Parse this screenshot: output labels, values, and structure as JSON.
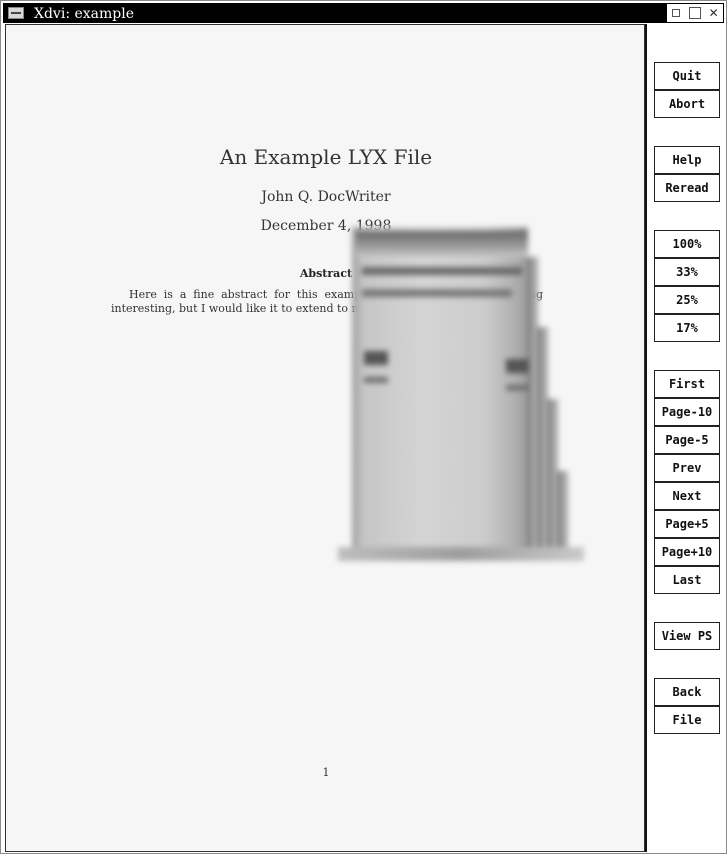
{
  "window": {
    "title": "Xdvi:  example",
    "menu_icon": "window-menu-icon",
    "controls": {
      "minimize_icon": "minimize-icon",
      "maximize_icon": "maximize-icon",
      "close_icon": "close-icon",
      "close_glyph": "✕"
    }
  },
  "document": {
    "title": "An Example LYX File",
    "author": "John Q. DocWriter",
    "date": "December 4, 1998",
    "abstract_heading": "Abstract",
    "abstract_text": "Here is a fine abstract for this example document, which is nothing interesting, but I would like it to extend to more than one line.",
    "page_number": "1"
  },
  "magnifier": {
    "visible": true
  },
  "sidebar": {
    "buttons": [
      {
        "id": "quit",
        "label": "Quit"
      },
      {
        "id": "abort",
        "label": "Abort"
      },
      {
        "id": "help",
        "label": "Help"
      },
      {
        "id": "reread",
        "label": "Reread"
      },
      {
        "id": "zoom-100",
        "label": "100%"
      },
      {
        "id": "zoom-33",
        "label": "33%"
      },
      {
        "id": "zoom-25",
        "label": "25%"
      },
      {
        "id": "zoom-17",
        "label": "17%"
      },
      {
        "id": "first",
        "label": "First"
      },
      {
        "id": "page-minus-10",
        "label": "Page-10"
      },
      {
        "id": "page-minus-5",
        "label": "Page-5"
      },
      {
        "id": "prev",
        "label": "Prev"
      },
      {
        "id": "next",
        "label": "Next"
      },
      {
        "id": "page-plus-5",
        "label": "Page+5"
      },
      {
        "id": "page-plus-10",
        "label": "Page+10"
      },
      {
        "id": "last",
        "label": "Last"
      },
      {
        "id": "view-ps",
        "label": "View PS"
      },
      {
        "id": "back",
        "label": "Back"
      },
      {
        "id": "file",
        "label": "File"
      }
    ]
  },
  "colors": {
    "titlebar": "#000000",
    "page_background": "#f6f6f6",
    "text": "#333333"
  }
}
